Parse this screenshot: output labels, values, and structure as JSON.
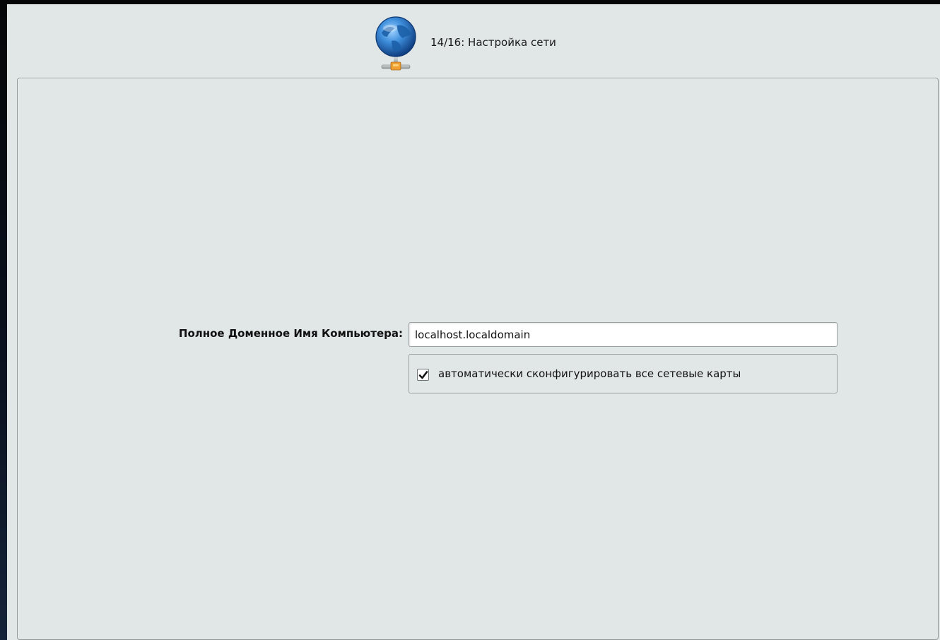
{
  "header": {
    "step_title": "14/16: Настройка сети",
    "icon": "network-globe-icon"
  },
  "form": {
    "hostname_label": "Полное Доменное Имя Компьютера:",
    "hostname_value": "localhost.localdomain",
    "auto_config_checked": true,
    "auto_config_label": "автоматически сконфигурировать все сетевые карты"
  },
  "colors": {
    "background": "#e1e7e6",
    "panel_border": "#8f9695",
    "globe_blue": "#2f7fcf",
    "connector_orange": "#f0a030"
  }
}
